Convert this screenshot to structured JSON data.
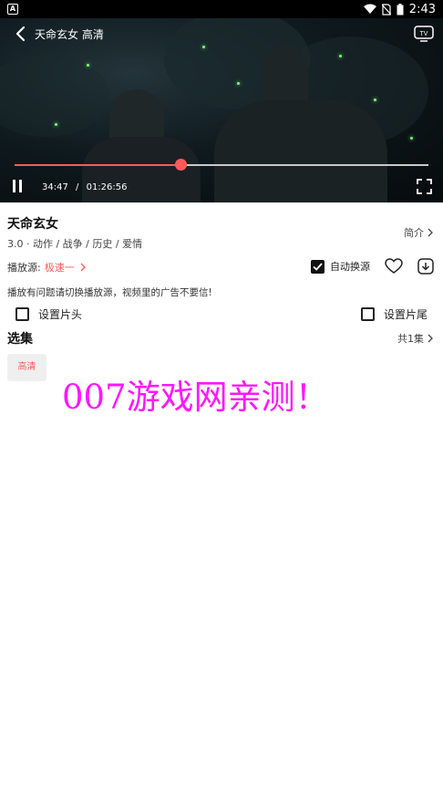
{
  "status_bar": {
    "time": "2:43"
  },
  "player": {
    "title": "天命玄女  高清",
    "current_time": "34:47",
    "time_separator": "/",
    "duration": "01:26:56",
    "progress": 0.4
  },
  "info": {
    "title": "天命玄女",
    "meta": "3.0 · 动作 / 战争 / 历史 / 爱情",
    "intro_label": "简介"
  },
  "source": {
    "label": "播放源:",
    "value": "极速一",
    "auto_switch_label": "自动换源",
    "auto_switch_checked": true
  },
  "notice": "播放有问题请切换播放源，视频里的广告不要信!",
  "options": {
    "intro_label": "设置片头",
    "outro_label": "设置片尾"
  },
  "episodes": {
    "heading": "选集",
    "count_label": "共1集",
    "items": [
      {
        "label": "高清"
      }
    ]
  },
  "watermark": "007游戏网亲测！",
  "colors": {
    "accent": "#ff5a5a",
    "watermark": "#ff17ff"
  },
  "icons": [
    "back-icon",
    "tv-cast-icon",
    "pause-icon",
    "fullscreen-icon",
    "chevron-right-icon",
    "checkbox-icon",
    "heart-icon",
    "download-icon",
    "wifi-icon",
    "battery-icon"
  ]
}
